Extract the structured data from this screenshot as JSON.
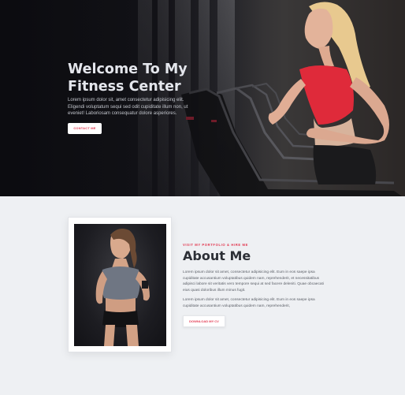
{
  "hero": {
    "title_line1": "Welcome To My",
    "title_line2": "Fitness Center",
    "description": "Lorem ipsum dolor sit, amet consectetur adipisicing elit. Eligendi voluptatum sequi sed odit cupiditate illum non, ut eveniet! Laboriosam consequatur dolore asperiores.",
    "button": "CONTACT ME"
  },
  "about": {
    "eyebrow": "VISIT MY PORTFOLIO & HIRE ME",
    "heading": "About Me",
    "paragraph1": "Lorem ipsum dolor sit amet, consectetur adipisicing elit. Eum in eos saepe ipsa cupiditate accusantium voluptatibus quidem nam, reprehenderit, et necessitatibus adipisci labore sit veritatis vero tempore sequi at sed facere deleniti. Quae obcaecati eius quasi doloribus illum minus fugit.",
    "paragraph2": "Lorem ipsum dolor sit amet, consectetur adipisicing elit. Eum in eos saepe ipsa cupiditate accusantium voluptatibus quidem nam, reprehenderit,",
    "button": "DOWNLOAD MY CV"
  },
  "colors": {
    "accent": "#e23a52",
    "hero_bg": "#1d1c22",
    "page_bg": "#eef0f3",
    "heading": "#2c2f36"
  }
}
